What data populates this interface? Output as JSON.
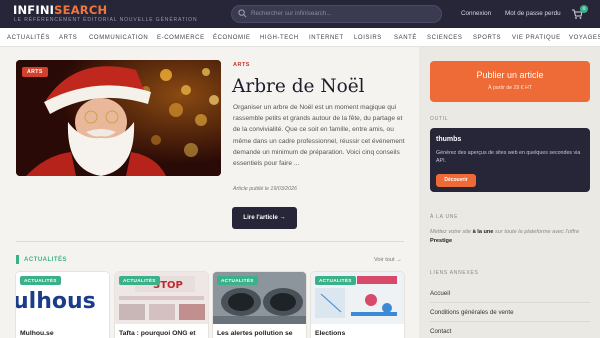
{
  "header": {
    "logo_main": "INFINI",
    "logo_accent": "SEARCH",
    "tagline": "LE RÉFÉRENCEMENT ÉDITORIAL NOUVELLE GÉNÉRATION",
    "search_placeholder": "Rechercher sur infinisearch...",
    "login": "Connexion",
    "forgot_password": "Mot de passe perdu",
    "cart_count": "0"
  },
  "nav": [
    "ACTUALITÉS",
    "ARTS",
    "COMMUNICATION",
    "E-COMMERCE",
    "ÉCONOMIE",
    "HIGH-TECH",
    "INTERNET",
    "LOISIRS",
    "SANTÉ",
    "SCIENCES",
    "SPORTS",
    "VIE PRATIQUE",
    "VOYAGES"
  ],
  "featured": {
    "badge": "ARTS",
    "category": "ARTS",
    "title": "Arbre de Noël",
    "excerpt": "Organiser un arbre de Noël est un moment magique qui rassemble petits et grands autour de la fête, du partage et de la convivialité. Que ce soit en famille, entre amis, ou même dans un cadre professionnel, réussir cet événement demande un minimum de préparation. Voici cinq conseils essentiels pour faire ...",
    "pubdate": "Article publié le 19/03/2026",
    "read_label": "Lire l'article →"
  },
  "news": {
    "section_title": "ACTUALITÉS",
    "see_all": "Voir tout →",
    "cards": [
      {
        "badge": "ACTUALITÉS",
        "title": "Mulhou.se",
        "image_text": "ulhous"
      },
      {
        "badge": "ACTUALITÉS",
        "title": "Tafta : pourquoi ONG et",
        "image_text": "STOP"
      },
      {
        "badge": "ACTUALITÉS",
        "title": "Les alertes pollution se",
        "image_text": ""
      },
      {
        "badge": "ACTUALITÉS",
        "title": "Elections",
        "image_text": ""
      }
    ]
  },
  "sidebar": {
    "publish_title": "Publier un article",
    "publish_sub": "À partir de 29 € HT",
    "tool_label": "OUTIL",
    "tool_name": "thumbs",
    "tool_desc": "Générez des aperçus de sites web en quelques secondes via API.",
    "tool_button": "Découvrir",
    "une_label": "À LA UNE",
    "une_pre": "Mettez votre site ",
    "une_bold": "à la une",
    "une_mid": " sur toute la plateforme avec l'offre ",
    "une_offer": "Prestige",
    "links_label": "LIENS ANNEXES",
    "links": [
      "Accueil",
      "Conditions générales de vente",
      "Contact"
    ]
  },
  "colors": {
    "header_bg": "#262638",
    "accent_orange": "#ee6a36",
    "accent_green": "#3bb18a",
    "arts_red": "#d2402e"
  }
}
